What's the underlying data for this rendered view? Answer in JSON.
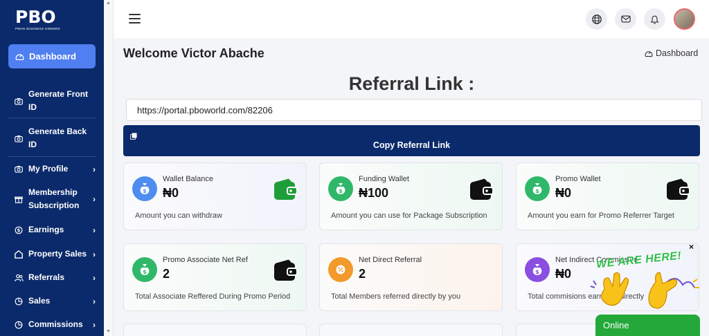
{
  "brand": {
    "logo_text": "PBO",
    "logo_subtitle": "PWAN BUSINESS OWNERS"
  },
  "sidebar": {
    "active": {
      "label": "Dashboard",
      "icon": "dashboard-icon"
    },
    "items": [
      {
        "label": "Generate Front ID",
        "icon": "camera-icon",
        "chevron": false
      },
      {
        "label": "Generate Back ID",
        "icon": "camera-icon",
        "chevron": false
      },
      {
        "label": "My Profile",
        "icon": "camera-icon",
        "chevron": true
      },
      {
        "label": "Membership Subscription",
        "icon": "gift-icon",
        "chevron": true
      },
      {
        "label": "Earnings",
        "icon": "dollar-circle-icon",
        "chevron": true
      },
      {
        "label": "Property Sales",
        "icon": "home-icon",
        "chevron": true
      },
      {
        "label": "Referrals",
        "icon": "users-icon",
        "chevron": true
      },
      {
        "label": "Sales",
        "icon": "pie-chart-icon",
        "chevron": true
      },
      {
        "label": "Commissions",
        "icon": "pie-chart-icon",
        "chevron": true
      }
    ],
    "chevron_glyph": "›"
  },
  "header": {
    "icons": [
      "menu-icon",
      "globe-icon",
      "mail-icon",
      "bell-icon",
      "avatar"
    ]
  },
  "main": {
    "welcome": "Welcome Victor Abache",
    "breadcrumb": "Dashboard",
    "referral_title": "Referral Link :",
    "referral_url": "https://portal.pboworld.com/82206",
    "copy_label": "Copy Referral Link"
  },
  "cards": [
    {
      "title": "Wallet Balance",
      "value": "₦0",
      "desc": "Amount you can withdraw",
      "badge_color": "#4e8cf0",
      "badge_icon": "money-bag-icon",
      "wallet_color": "#1f9d3a"
    },
    {
      "title": "Funding Wallet",
      "value": "₦100",
      "desc": "Amount you can use for Package Subscription",
      "badge_color": "#2fb86a",
      "badge_icon": "money-bag-icon",
      "wallet_color": "#111111"
    },
    {
      "title": "Promo Wallet",
      "value": "₦0",
      "desc": "Amount you earn for Promo Referrer Target",
      "badge_color": "#2fb86a",
      "badge_icon": "money-bag-icon",
      "wallet_color": "#111111"
    },
    {
      "title": "Promo Associate Net Ref",
      "value": "2",
      "desc": "Total Associate Reffered During Promo Period",
      "badge_color": "#2fb86a",
      "badge_icon": "money-bag-icon",
      "wallet_color": "#111111"
    },
    {
      "title": "Net Direct Referral",
      "value": "2",
      "desc": "Total Members referred directly by you",
      "badge_color": "#f29a2b",
      "badge_icon": "percent-icon",
      "wallet_color": ""
    },
    {
      "title": "Net Indirect Commission",
      "value": "₦0",
      "desc": "Total commisions earned indirectly",
      "badge_color": "#8a4fe0",
      "badge_icon": "money-bag-icon",
      "wallet_color": ""
    }
  ],
  "chat": {
    "banner": "WE ARE HERE!",
    "close": "×",
    "status": "Online"
  }
}
